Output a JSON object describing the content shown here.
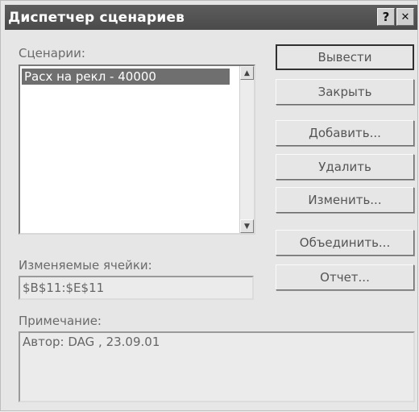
{
  "window": {
    "title": "Диспетчер сценариев",
    "help_label": "?",
    "close_label": "✕"
  },
  "scenarios": {
    "label": "Сценарии:",
    "items": [
      "Расх на рекл - 40000"
    ],
    "selected_index": 0
  },
  "buttons": {
    "show": "Вывести",
    "close": "Закрыть",
    "add": "Добавить...",
    "delete": "Удалить",
    "edit": "Изменить...",
    "merge": "Объединить...",
    "report": "Отчет..."
  },
  "changing_cells": {
    "label": "Изменяемые ячейки:",
    "value": "$B$11:$E$11"
  },
  "comment": {
    "label": "Примечание:",
    "value": "Автор: DAG , 23.09.01"
  }
}
